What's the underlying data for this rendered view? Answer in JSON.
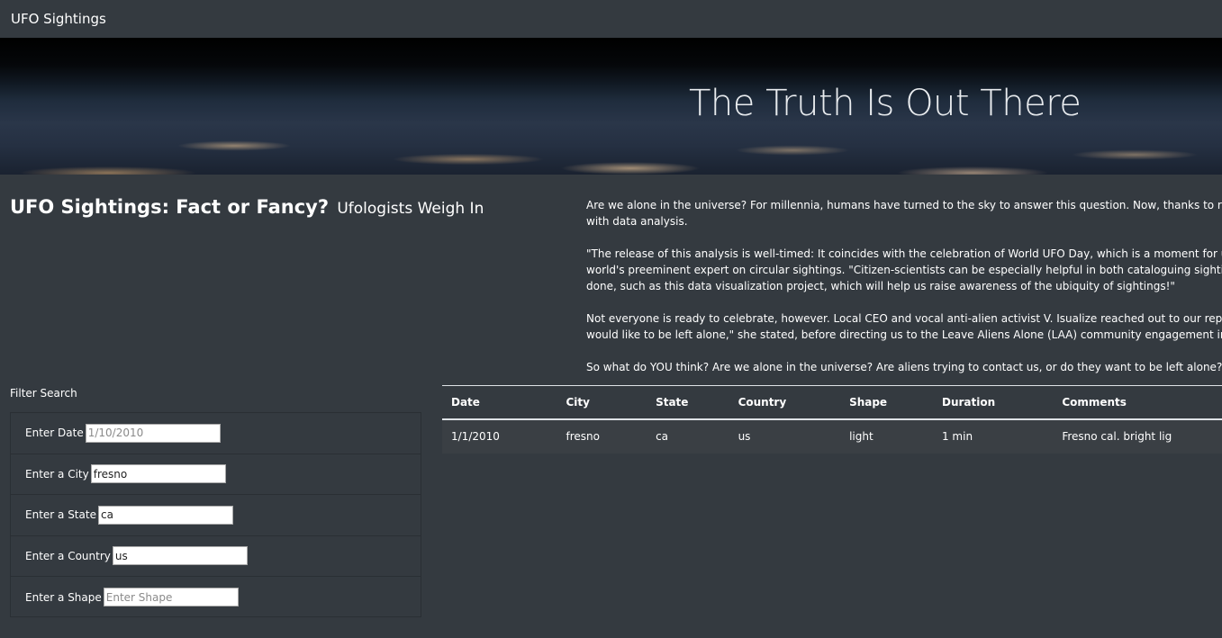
{
  "navbar": {
    "brand": "UFO Sightings"
  },
  "hero": {
    "title": "The Truth Is Out There"
  },
  "headline": {
    "title": "UFO Sightings: Fact or Fancy?",
    "subtitle": "Ufologists Weigh In"
  },
  "article": {
    "p1": [
      "Are we alone in the universe? For millennia, humans have turned to the sky to answer this question. Now, thanks to research generous",
      "with data analysis."
    ],
    "p2": [
      "\"The release of this analysis is well-timed: It coincides with the celebration of World UFO Day, which is a moment for ufologists around",
      "world's preeminent expert on circular sightings. \"Citizen-scientists can be especially helpful in both cataloguing sightings—which is hu",
      "done, such as this data visualization project, which will help us raise awareness of the ubiquity of sightings!\""
    ],
    "p3": [
      "Not everyone is ready to celebrate, however. Local CEO and vocal anti-alien activist V. Isualize reached out to our reporters to go on re",
      "would like to be left alone,\" she stated, before directing us to the Leave Aliens Alone (LAA) community engagement initiative she foun"
    ],
    "p4": [
      "So what do YOU think? Are we alone in the universe? Are aliens trying to contact us, or do they want to be left alone? Dig through the"
    ]
  },
  "filters": {
    "heading": "Filter Search",
    "items": [
      {
        "label": "Enter Date",
        "value": "",
        "placeholder": "1/10/2010"
      },
      {
        "label": "Enter a City",
        "value": "fresno",
        "placeholder": ""
      },
      {
        "label": "Enter a State",
        "value": "ca",
        "placeholder": ""
      },
      {
        "label": "Enter a Country",
        "value": "us",
        "placeholder": ""
      },
      {
        "label": "Enter a Shape",
        "value": "",
        "placeholder": "Enter Shape"
      }
    ]
  },
  "table": {
    "columns": [
      "Date",
      "City",
      "State",
      "Country",
      "Shape",
      "Duration",
      "Comments"
    ],
    "rows": [
      [
        "1/1/2010",
        "fresno",
        "ca",
        "us",
        "light",
        "1 min",
        "Fresno cal. bright lig"
      ]
    ]
  }
}
